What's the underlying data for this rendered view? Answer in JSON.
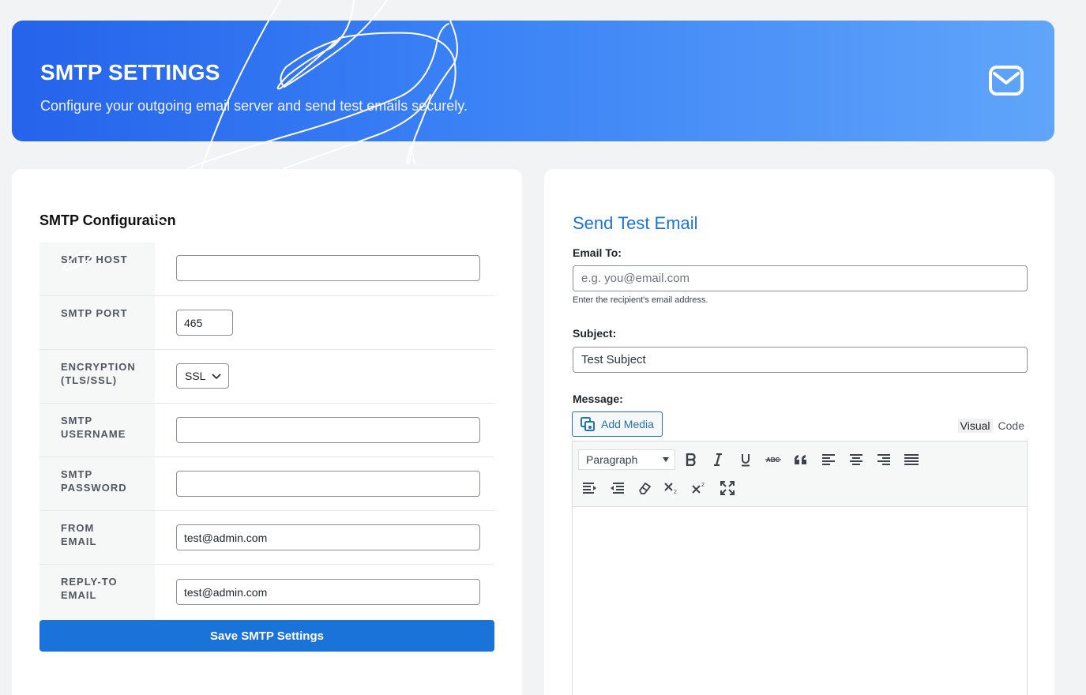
{
  "header": {
    "title": "SMTP SETTINGS",
    "subtitle": "Configure your outgoing email server and send test emails securely.",
    "icon": "mail-icon"
  },
  "smtp_config": {
    "title": "SMTP Configuration",
    "fields": [
      {
        "label": "SMTP HOST",
        "value": "",
        "type": "text"
      },
      {
        "label": "SMTP PORT",
        "value": "465",
        "type": "number"
      },
      {
        "label": "ENCRYPTION (TLS/SSL)",
        "value": "SSL",
        "type": "select"
      },
      {
        "label": "SMTP USERNAME",
        "value": "",
        "type": "text"
      },
      {
        "label": "SMTP PASSWORD",
        "value": "",
        "type": "password"
      },
      {
        "label": "FROM EMAIL",
        "value": "test@admin.com",
        "type": "text"
      },
      {
        "label": "REPLY-TO EMAIL",
        "value": "test@admin.com",
        "type": "text"
      }
    ],
    "save_label": "Save SMTP Settings"
  },
  "test_email": {
    "title": "Send Test Email",
    "email_to_label": "Email To:",
    "email_to_placeholder": "e.g. you@email.com",
    "email_to_hint": "Enter the recipient's email address.",
    "subject_label": "Subject:",
    "subject_value": "Test Subject",
    "message_label": "Message:",
    "add_media_label": "Add Media",
    "tab_visual": "Visual",
    "tab_code": "Code",
    "format_value": "Paragraph"
  },
  "colors": {
    "accent": "#1a73d9",
    "hero_start": "#2563eb",
    "hero_end": "#60a5fa"
  }
}
